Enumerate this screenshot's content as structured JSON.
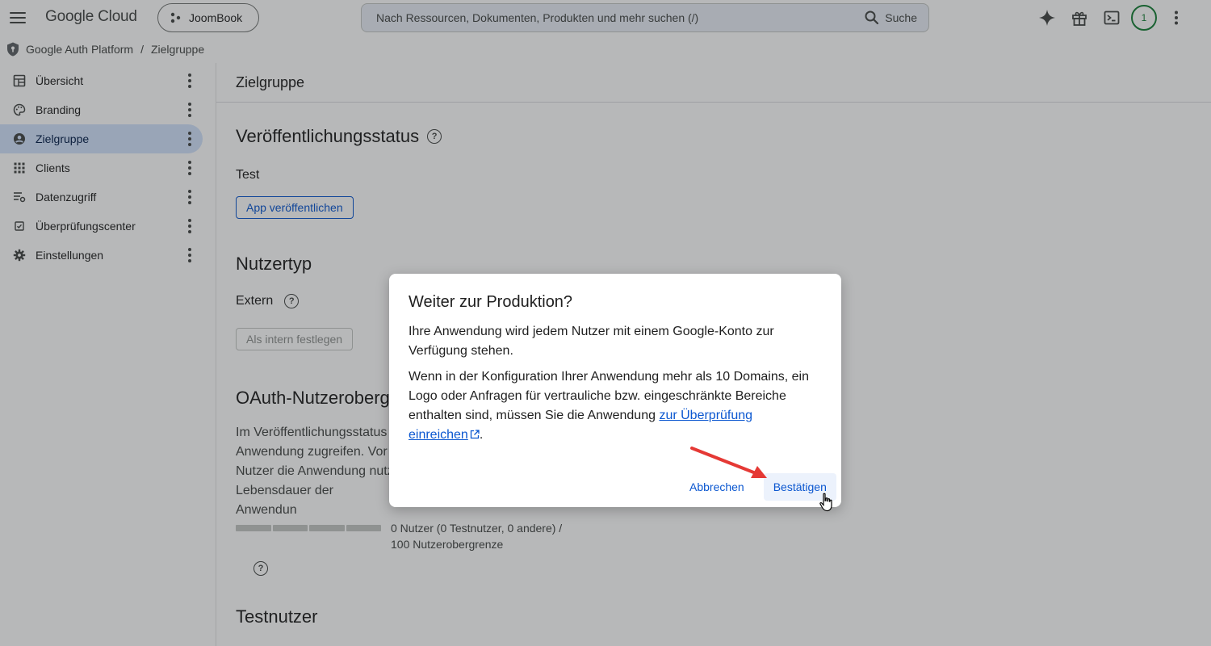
{
  "topbar": {
    "logo": "Google Cloud",
    "project": "JoomBook",
    "search_placeholder": "Nach Ressourcen, Dokumenten, Produkten und mehr suchen (/)",
    "search_button": "Suche",
    "avatar": "1"
  },
  "breadcrumb": {
    "root": "Google Auth Platform",
    "separator": "/",
    "current": "Zielgruppe"
  },
  "sidebar": {
    "items": [
      {
        "label": "Übersicht",
        "icon": "dashboard-icon"
      },
      {
        "label": "Branding",
        "icon": "palette-icon"
      },
      {
        "label": "Zielgruppe",
        "icon": "person-icon",
        "active": true
      },
      {
        "label": "Clients",
        "icon": "apps-grid-icon"
      },
      {
        "label": "Datenzugriff",
        "icon": "data-access-icon"
      },
      {
        "label": "Überprüfungscenter",
        "icon": "verify-icon"
      },
      {
        "label": "Einstellungen",
        "icon": "gear-icon"
      }
    ]
  },
  "main": {
    "header": "Zielgruppe",
    "publish": {
      "title": "Veröffentlichungsstatus",
      "status": "Test",
      "button": "App veröffentlichen"
    },
    "user_type": {
      "title": "Nutzertyp",
      "value": "Extern",
      "button": "Als intern festlegen"
    },
    "oauth": {
      "title": "OAuth-Nutzeroberg",
      "lines": [
        "Im Veröffentlichungsstatus",
        "Anwendung zugreifen. Vor",
        "Nutzer die Anwendung nutz",
        "Lebensdauer der Anwendun"
      ],
      "usage_line1": "0 Nutzer (0 Testnutzer, 0 andere) /",
      "usage_line2": "100 Nutzerobergrenze"
    },
    "test_users": {
      "title": "Testnutzer"
    }
  },
  "dialog": {
    "title": "Weiter zur Produktion?",
    "p1": "Ihre Anwendung wird jedem Nutzer mit einem Google-Konto zur Verfügung stehen.",
    "p2_line1": "Wenn in der Konfiguration Ihrer Anwendung mehr als 10 Domains, ein",
    "p2_line2": "Logo oder Anfragen für vertrauliche bzw. eingeschränkte Bereiche",
    "p2_line3_prefix": "enthalten sind, müssen Sie die Anwendung ",
    "link_part1": "zur Überprüfung",
    "link_part2": "einreichen",
    "p2_end": ".",
    "cancel": "Abbrechen",
    "confirm": "Bestätigen"
  },
  "colors": {
    "accent": "#0b57d0",
    "active_nav": "#d3e3fd",
    "annotation_arrow": "#e53935",
    "avatar_ring": "#188038"
  }
}
